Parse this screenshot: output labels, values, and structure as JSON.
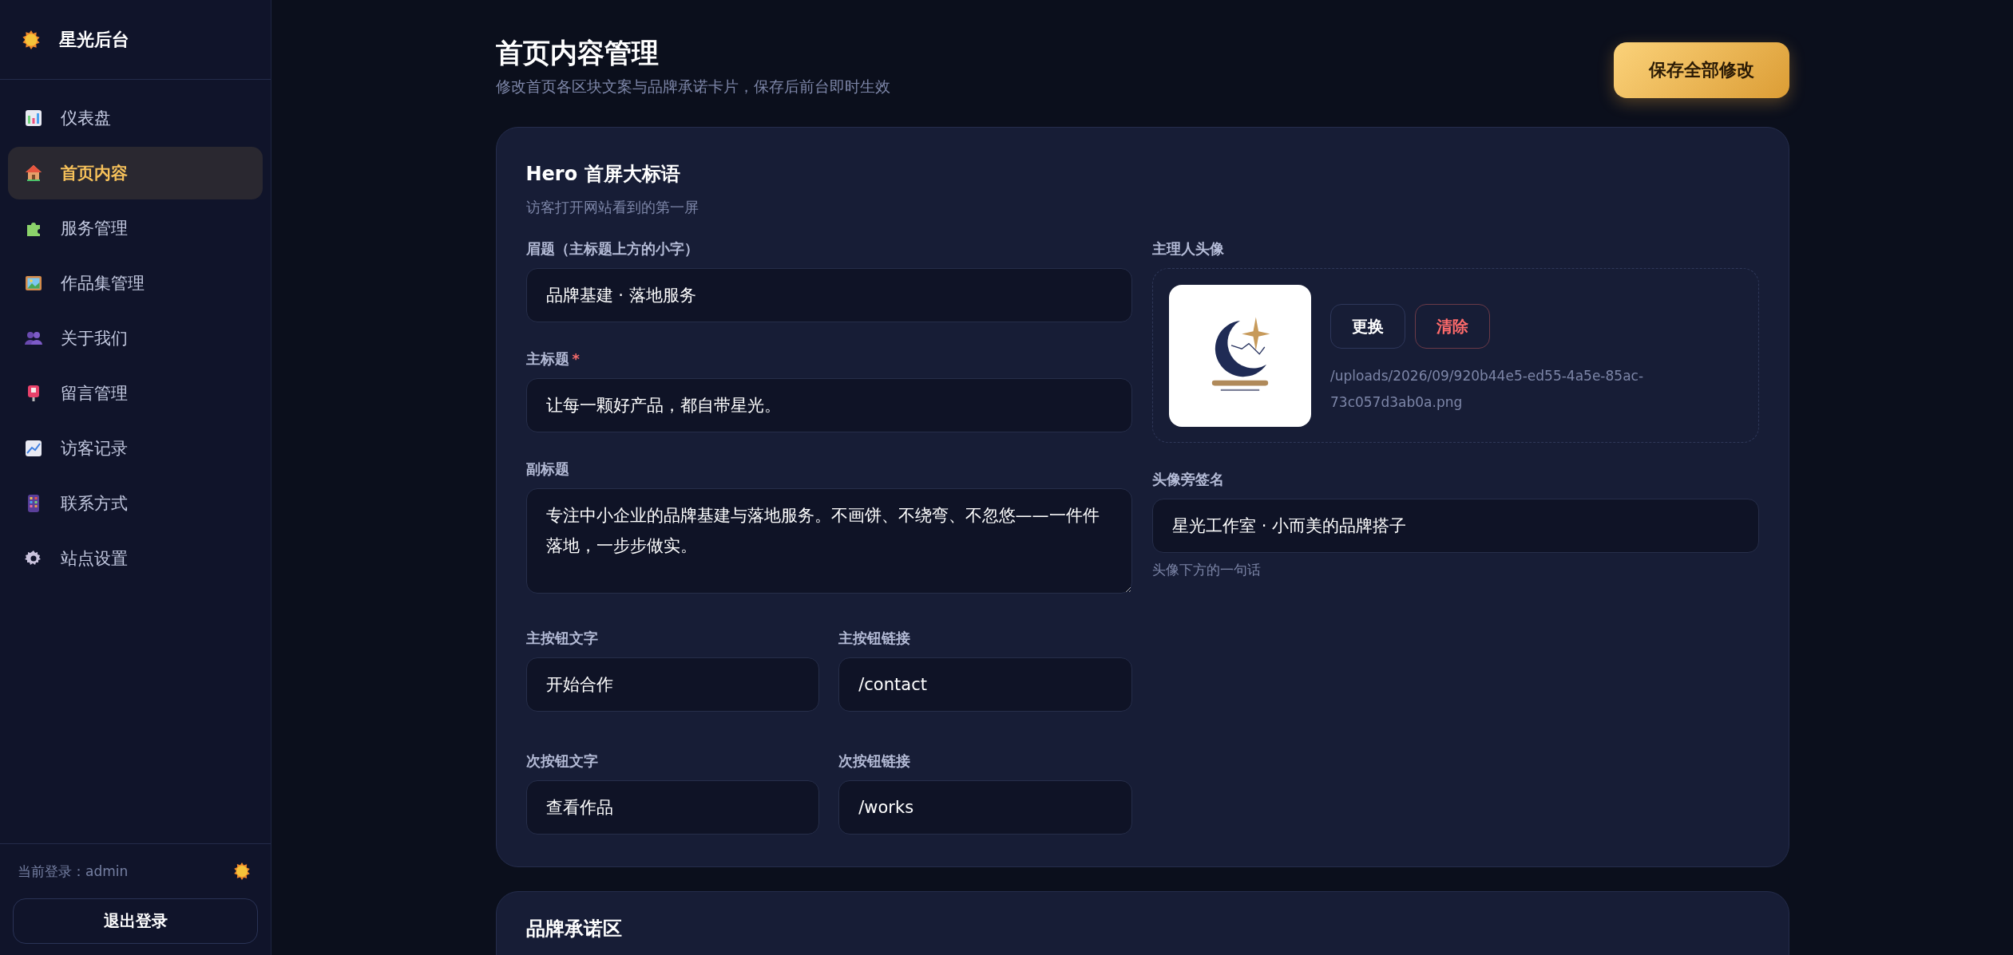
{
  "sidebar": {
    "brand": "星光后台",
    "items": [
      {
        "label": "仪表盘",
        "selected": false
      },
      {
        "label": "首页内容",
        "selected": true
      },
      {
        "label": "服务管理",
        "selected": false
      },
      {
        "label": "作品集管理",
        "selected": false
      },
      {
        "label": "关于我们",
        "selected": false
      },
      {
        "label": "留言管理",
        "selected": false
      },
      {
        "label": "访客记录",
        "selected": false
      },
      {
        "label": "联系方式",
        "selected": false
      },
      {
        "label": "站点设置",
        "selected": false
      }
    ],
    "current_user": "当前登录：admin",
    "logout": "退出登录"
  },
  "header": {
    "title": "首页内容管理",
    "subtitle": "修改首页各区块文案与品牌承诺卡片，保存后前台即时生效",
    "save_button": "保存全部修改"
  },
  "hero_card": {
    "title": "Hero 首屏大标语",
    "subtitle": "访客打开网站看到的第一屏",
    "eyebrow": {
      "label": "眉题（主标题上方的小字）",
      "value": "品牌基建 · 落地服务"
    },
    "main_title": {
      "label": "主标题",
      "required_mark": "*",
      "value": "让每一颗好产品，都自带星光。"
    },
    "subheading": {
      "label": "副标题",
      "value": "专注中小企业的品牌基建与落地服务。不画饼、不绕弯、不忽悠——一件件落地，一步步做实。"
    },
    "buttons": [
      {
        "label": "主按钮文字",
        "value": "开始合作"
      },
      {
        "label": "主按钮链接",
        "value": "/contact"
      },
      {
        "label": "次按钮文字",
        "value": "查看作品"
      },
      {
        "label": "次按钮链接",
        "value": "/works"
      }
    ],
    "avatar": {
      "label": "主理人头像",
      "replace": "更换",
      "clear": "清除",
      "path": "/uploads/2026/09/920b44e5-ed55-4a5e-85ac-73c057d3ab0a.png"
    },
    "signature": {
      "label": "头像旁签名",
      "value": "星光工作室 · 小而美的品牌搭子",
      "hint": "头像下方的一句话"
    }
  },
  "promise_card": {
    "title": "品牌承诺区"
  }
}
